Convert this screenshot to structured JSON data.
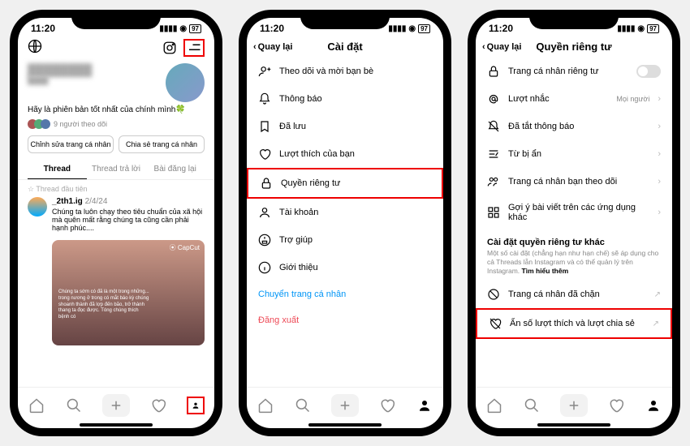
{
  "statusbar": {
    "time": "11:20",
    "battery": "97"
  },
  "screen1": {
    "bio": "Hãy là phiên bản tốt nhất của chính mình🍀",
    "followers": "9 người theo dõi",
    "btn_edit": "Chỉnh sửa trang cá nhân",
    "btn_share": "Chia sẻ trang cá nhân",
    "tabs": [
      "Thread",
      "Thread trả lời",
      "Bài đăng lại"
    ],
    "pinned": "☆ Thread đầu tiên",
    "post_user": "_2th1.ig",
    "post_date": "2/4/24",
    "post_text": "Chúng ta luôn chạy theo tiêu chuẩn của xã hội mà quên mất rằng chúng ta cũng cần phải hạnh phúc....",
    "capcut": "⦿ CapCut"
  },
  "screen2": {
    "back": "Quay lại",
    "title": "Cài đặt",
    "items": [
      "Theo dõi và mời bạn bè",
      "Thông báo",
      "Đã lưu",
      "Lượt thích của bạn",
      "Quyền riêng tư",
      "Tài khoản",
      "Trợ giúp",
      "Giới thiệu"
    ],
    "switch": "Chuyển trang cá nhân",
    "logout": "Đăng xuất"
  },
  "screen3": {
    "back": "Quay lại",
    "title": "Quyền riêng tư",
    "items": [
      {
        "label": "Trang cá nhân riêng tư"
      },
      {
        "label": "Lượt nhắc",
        "value": "Mọi người"
      },
      {
        "label": "Đã tắt thông báo"
      },
      {
        "label": "Từ bị ẩn"
      },
      {
        "label": "Trang cá nhân bạn theo dõi"
      },
      {
        "label": "Gợi ý bài viết trên các ứng dụng khác"
      }
    ],
    "section_title": "Cài đặt quyền riêng tư khác",
    "section_desc": "Một số cài đặt (chẳng hạn như hạn chế) sẽ áp dụng cho cả Threads lẫn Instagram và có thể quản lý trên Instagram. ",
    "section_more": "Tìm hiểu thêm",
    "items2": [
      "Trang cá nhân đã chặn",
      "Ẩn số lượt thích và lượt chia sẻ"
    ]
  }
}
